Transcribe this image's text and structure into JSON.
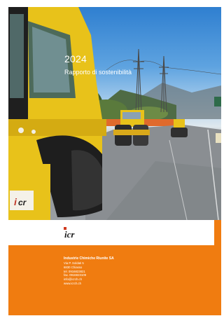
{
  "cover": {
    "year": "2024",
    "subtitle": "Rapporto di sostenibilità"
  },
  "logo": {
    "text": "icr"
  },
  "footer": {
    "company": "Industrie Chimiche Riunite SA",
    "address_lines": [
      "Via P. Soldati 5",
      "6830 Chiasso",
      "tel. 0916823821",
      "fax. 0916823109",
      "info@icrch.ch",
      "www.icrch.ch"
    ]
  },
  "colors": {
    "accent": "#f07c10",
    "roller": "#e8c21a"
  }
}
